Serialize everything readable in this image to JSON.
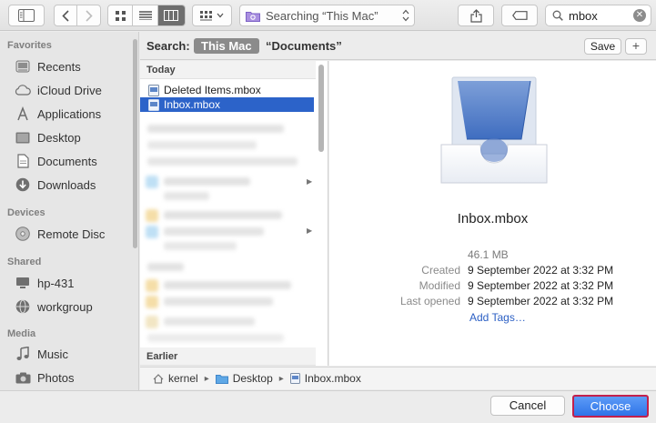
{
  "toolbar": {
    "scope_text": "Searching “This Mac”",
    "search_value": "mbox"
  },
  "sidebar": {
    "sections": [
      {
        "title": "Favorites",
        "items": [
          "Recents",
          "iCloud Drive",
          "Applications",
          "Desktop",
          "Documents",
          "Downloads"
        ]
      },
      {
        "title": "Devices",
        "items": [
          "Remote Disc"
        ]
      },
      {
        "title": "Shared",
        "items": [
          "hp-431",
          "workgroup"
        ]
      },
      {
        "title": "Media",
        "items": [
          "Music",
          "Photos"
        ]
      }
    ]
  },
  "scopebar": {
    "search_label": "Search:",
    "this_mac": "This Mac",
    "documents": "“Documents”",
    "save_label": "Save",
    "plus_label": "+"
  },
  "list": {
    "groups": [
      "Today",
      "Earlier"
    ],
    "files": [
      {
        "name": "Deleted Items.mbox",
        "selected": false
      },
      {
        "name": "Inbox.mbox",
        "selected": true
      }
    ]
  },
  "preview": {
    "name": "Inbox.mbox",
    "size": "46.1 MB",
    "created_label": "Created",
    "created_value": "9 September 2022 at 3:32 PM",
    "modified_label": "Modified",
    "modified_value": "9 September 2022 at 3:32 PM",
    "opened_label": "Last opened",
    "opened_value": "9 September 2022 at 3:32 PM",
    "add_tags": "Add Tags…"
  },
  "pathbar": {
    "segments": [
      "kernel",
      "Desktop",
      "Inbox.mbox"
    ]
  },
  "footer": {
    "cancel_label": "Cancel",
    "choose_label": "Choose"
  },
  "colors": {
    "selection": "#2c63c9",
    "accent_button": "#3b7ff0",
    "highlight_border": "#c2204c"
  }
}
